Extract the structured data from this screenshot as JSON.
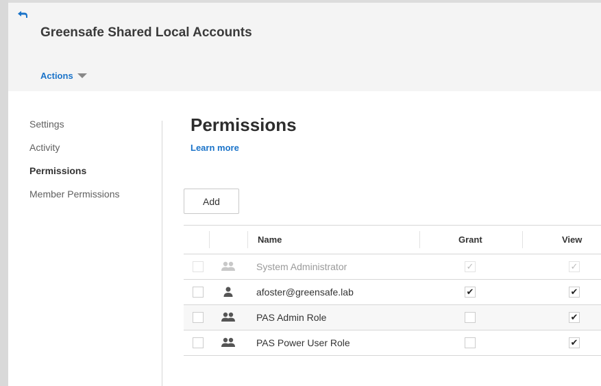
{
  "header": {
    "title": "Greensafe Shared Local Accounts",
    "actions_label": "Actions",
    "accent_color": "#1a73c9"
  },
  "sidebar": {
    "items": [
      {
        "label": "Settings",
        "active": false
      },
      {
        "label": "Activity",
        "active": false
      },
      {
        "label": "Permissions",
        "active": true
      },
      {
        "label": "Member Permissions",
        "active": false
      }
    ]
  },
  "main": {
    "title": "Permissions",
    "learn_more": "Learn more",
    "add_label": "Add",
    "table": {
      "columns": [
        "Name",
        "Grant",
        "View"
      ],
      "rows": [
        {
          "name": "System Administrator",
          "icon": "group-icon",
          "grant": true,
          "view": true,
          "disabled": true
        },
        {
          "name": "afoster@greensafe.lab",
          "icon": "user-icon",
          "grant": true,
          "view": true,
          "disabled": false
        },
        {
          "name": "PAS Admin Role",
          "icon": "group-icon",
          "grant": false,
          "view": true,
          "disabled": false
        },
        {
          "name": "PAS Power User Role",
          "icon": "group-icon",
          "grant": false,
          "view": true,
          "disabled": false
        }
      ]
    }
  }
}
